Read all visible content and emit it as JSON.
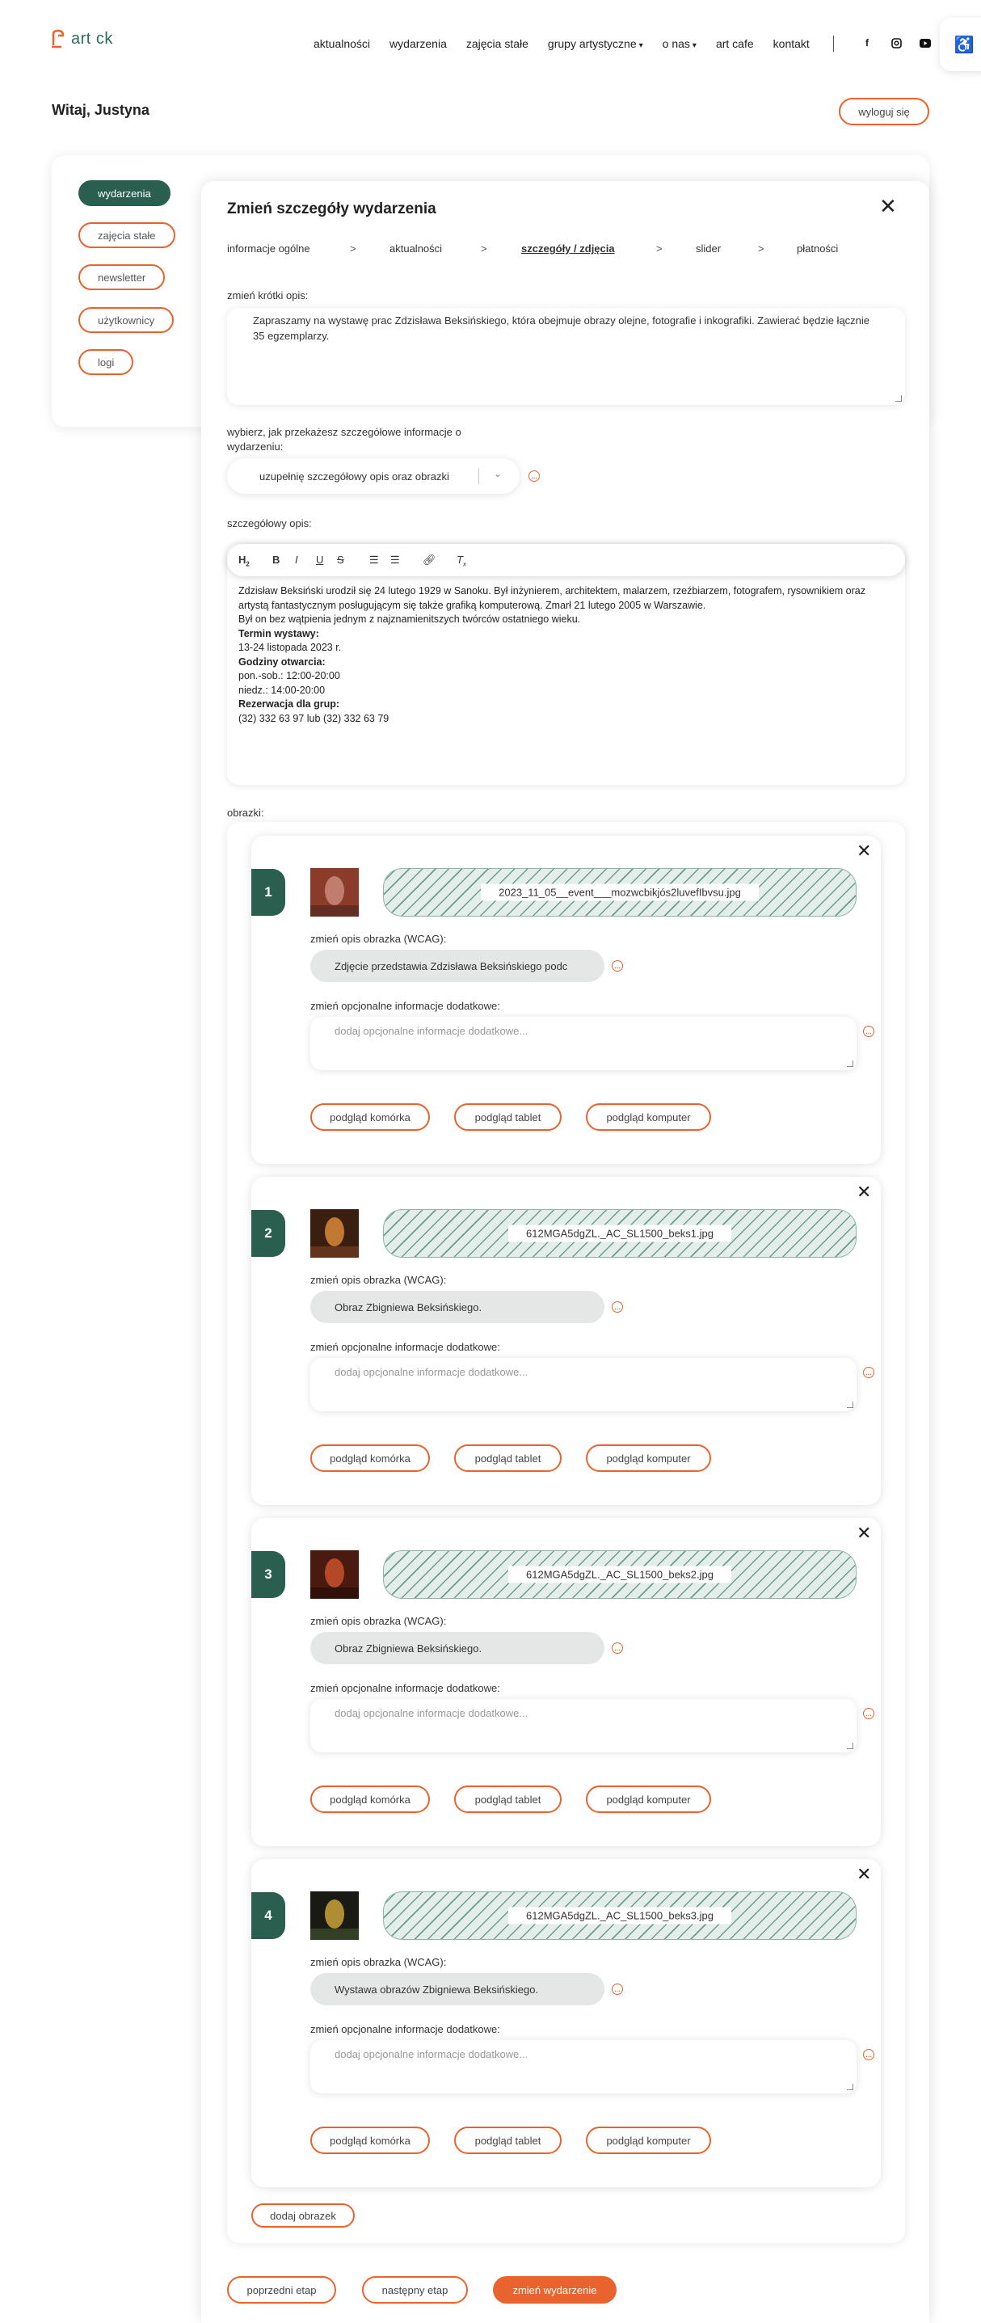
{
  "header": {
    "logo_text": "art ck",
    "nav": [
      "aktualności",
      "wydarzenia",
      "zajęcia stałe",
      "grupy artystyczne",
      "o nas",
      "art cafe",
      "kontakt"
    ],
    "social": [
      "facebook-icon",
      "instagram-icon",
      "youtube-icon"
    ],
    "accessibility_icon": "wheelchair-icon",
    "greeting": "Witaj, Justyna",
    "logout_label": "wyloguj się"
  },
  "sidebar": {
    "items": [
      {
        "label": "wydarzenia",
        "active": true
      },
      {
        "label": "zajęcia stałe",
        "active": false
      },
      {
        "label": "newsletter",
        "active": false
      },
      {
        "label": "użytkownicy",
        "active": false
      },
      {
        "label": "logi",
        "active": false
      }
    ]
  },
  "modal": {
    "title": "Zmień szczegóły wydarzenia",
    "steps": [
      "informacje ogólne",
      "aktualności",
      "szczegóły / zdjęcia",
      "slider",
      "płatności"
    ],
    "active_step": "szczegóły / zdjęcia",
    "short_desc_label": "zmień krótki opis:",
    "short_desc_value": "Zapraszamy na wystawę prac Zdzisława Beksińskiego, która obejmuje obrazy olejne, fotografie i inkografiki. Zawierać będzie łącznie 35 egzemplarzy.",
    "choose_label": "wybierz, jak przekażesz szczegółowe informacje o wydarzeniu:",
    "choose_value": "uzupełnię szczegółowy opis oraz obrazki",
    "detail_label": "szczegółowy opis:",
    "toolbar": [
      "H2",
      "B",
      "I",
      "U",
      "S",
      "ordered-list-icon",
      "bullet-list-icon",
      "link-icon",
      "clear-format-icon"
    ],
    "detail": {
      "p1": "Zdzisław Beksiński urodził się 24 lutego 1929 w Sanoku. Był inżynierem, architektem, malarzem, rzeźbiarzem, fotografem, rysownikiem oraz artystą fantastycznym posługującym się także grafiką komputerową. Zmarł 21 lutego 2005 w Warszawie.",
      "p2": "Był on bez wątpienia jednym z najznamienitszych twórców ostatniego wieku.",
      "term_label": "Termin wystawy:",
      "term_value": "13-24 listopada 2023 r.",
      "hours_label": "Godziny otwarcia:",
      "hours_1": "pon.-sob.: 12:00-20:00",
      "hours_2": "niedz.: 14:00-20:00",
      "res_label": "Rezerwacja dla grup:",
      "res_value": "(32) 332 63 97 lub (32) 332 63 79"
    },
    "images_label": "obrazki:",
    "image_cards": [
      {
        "number": "1",
        "file": "2023_11_05__event___mozwcbikjós2luvefIbvsu.jpg",
        "wcag_label": "zmień opis obrazka (WCAG):",
        "wcag_value": "Zdjęcie przedstawia Zdzisława Beksińskiego podc",
        "extra_label": "zmień opcjonalne informacje dodatkowe:",
        "extra_placeholder": "dodaj opcjonalne informacje dodatkowe...",
        "thumb_colors": [
          "#8a3b2a",
          "#c98a7a",
          "#5a2a22"
        ]
      },
      {
        "number": "2",
        "file": "612MGA5dgZL._AC_SL1500_beks1.jpg",
        "wcag_label": "zmień opis obrazka (WCAG):",
        "wcag_value": "Obraz Zbigniewa Beksińskiego.",
        "extra_label": "zmień opcjonalne informacje dodatkowe:",
        "extra_placeholder": "dodaj opcjonalne informacje dodatkowe...",
        "thumb_colors": [
          "#3a1e10",
          "#d9883a",
          "#6b3a1e"
        ]
      },
      {
        "number": "3",
        "file": "612MGA5dgZL._AC_SL1500_beks2.jpg",
        "wcag_label": "zmień opis obrazka (WCAG):",
        "wcag_value": "Obraz Zbigniewa Beksińskiego.",
        "extra_label": "zmień opcjonalne informacje dodatkowe:",
        "extra_placeholder": "dodaj opcjonalne informacje dodatkowe...",
        "thumb_colors": [
          "#4a1a10",
          "#c8512a",
          "#2a0e08"
        ]
      },
      {
        "number": "4",
        "file": "612MGA5dgZL._AC_SL1500_beks3.jpg",
        "wcag_label": "zmień opis obrazka (WCAG):",
        "wcag_value": "Wystawa obrazów Zbigniewa Beksińskiego.",
        "extra_label": "zmień opcjonalne informacje dodatkowe:",
        "extra_placeholder": "dodaj opcjonalne informacje dodatkowe...",
        "thumb_colors": [
          "#1a1a14",
          "#c9a23a",
          "#3a4a2a"
        ]
      }
    ],
    "preview_buttons": [
      "podgląd komórka",
      "podgląd tablet",
      "podgląd komputer"
    ],
    "add_image_label": "dodaj obrazek",
    "prev_label": "poprzedni etap",
    "next_label": "następny etap",
    "submit_label": "zmień wydarzenie"
  },
  "colors": {
    "accent": "#e8632d",
    "brand": "#2a5f50"
  }
}
